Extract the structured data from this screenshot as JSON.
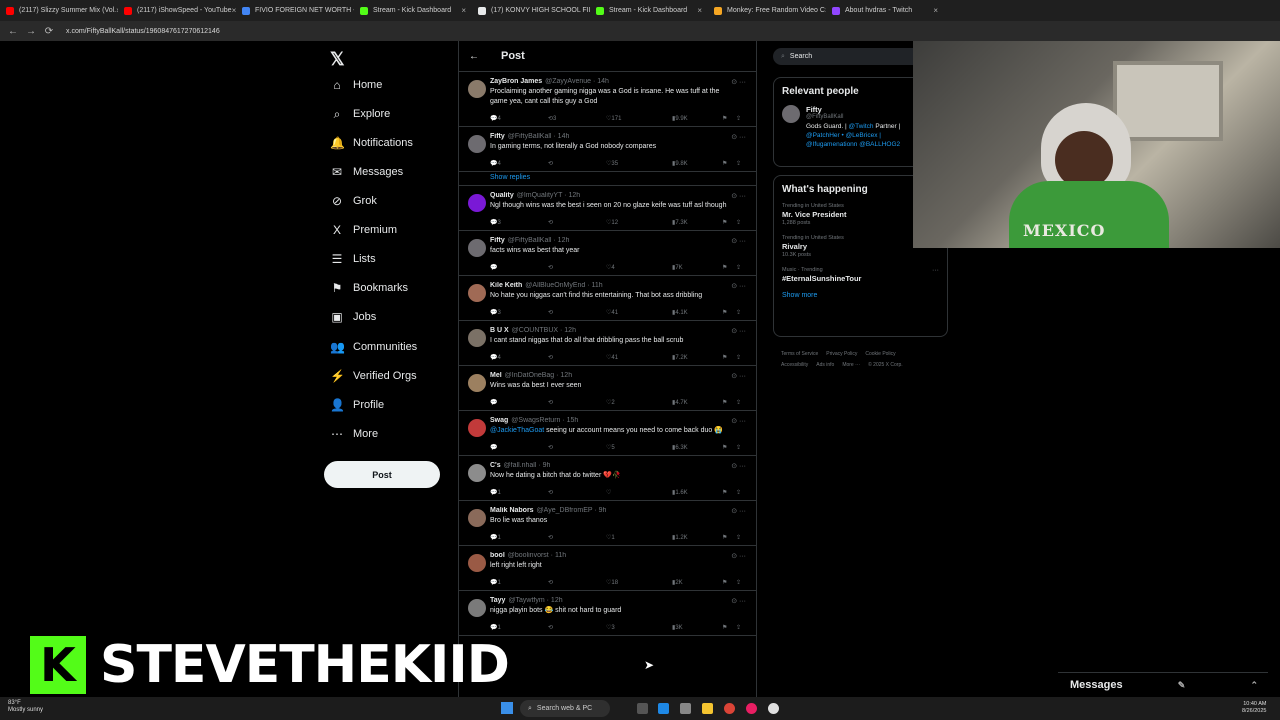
{
  "browser": {
    "tabs": [
      {
        "title": "(2117) Slizzy Summer Mix (Vol.",
        "color": "#ff0000"
      },
      {
        "title": "(2117) iShowSpeed - YouTube",
        "color": "#ff0000"
      },
      {
        "title": "FIVIO FOREIGN NET WORTH -",
        "color": "#4285f4"
      },
      {
        "title": "Stream - Kick Dashboard",
        "color": "#53fc18"
      },
      {
        "title": "(17) KONVY HIGH SCHOOL FII",
        "color": "#e7e9ea"
      },
      {
        "title": "Stream - Kick Dashboard",
        "color": "#53fc18"
      },
      {
        "title": "Monkey: Free Random Video C",
        "color": "#f5a623"
      },
      {
        "title": "About hvdras - Twitch",
        "color": "#9146ff"
      }
    ],
    "url": "x.com/FiftyBallKall/status/1960847617270612146"
  },
  "nav": {
    "items": [
      {
        "label": "Home",
        "icon": "⌂"
      },
      {
        "label": "Explore",
        "icon": "⌕"
      },
      {
        "label": "Notifications",
        "icon": "🔔"
      },
      {
        "label": "Messages",
        "icon": "✉"
      },
      {
        "label": "Grok",
        "icon": "⊘"
      },
      {
        "label": "Premium",
        "icon": "X"
      },
      {
        "label": "Lists",
        "icon": "☰"
      },
      {
        "label": "Bookmarks",
        "icon": "⚑"
      },
      {
        "label": "Jobs",
        "icon": "▣"
      },
      {
        "label": "Communities",
        "icon": "👥"
      },
      {
        "label": "Verified Orgs",
        "icon": "⚡"
      },
      {
        "label": "Profile",
        "icon": "👤"
      },
      {
        "label": "More",
        "icon": "⋯"
      }
    ],
    "post_label": "Post"
  },
  "main": {
    "title": "Post",
    "show_replies": "Show replies",
    "replies": [
      {
        "name": "ZayBron James",
        "handle": "@ZayyAvenue · 14h",
        "text": "Proclaiming another gaming nigga was a God is insane. He was tuff at the game yea, cant call this guy a God",
        "replies": "4",
        "reposts": "3",
        "likes": "171",
        "views": "9.9K",
        "avatar": "#8a7a6a"
      },
      {
        "name": "Fifty",
        "handle": "@FiftyBallKall · 14h",
        "text": "In gaming terms, not literally a God nobody compares",
        "replies": "4",
        "reposts": "",
        "likes": "35",
        "views": "9.8K",
        "avatar": "#6d6b70"
      },
      {
        "name": "Quality",
        "handle": "@ImQualityYT · 12h",
        "text": "Ngl though wins was the best i seen on 20 no glaze keife was tuff asl though",
        "replies": "3",
        "reposts": "",
        "likes": "12",
        "views": "7.3K",
        "avatar": "#7a19d6"
      },
      {
        "name": "Fifty",
        "handle": "@FiftyBallKall · 12h",
        "text": "facts wins was best that year",
        "replies": "",
        "reposts": "",
        "likes": "4",
        "views": "7K",
        "avatar": "#6d6b70"
      },
      {
        "name": "Kile Keith",
        "handle": "@AllBlueOnMyEnd · 11h",
        "text": "No hate you niggas can't find this entertaining. That bot ass dribbling",
        "replies": "3",
        "reposts": "",
        "likes": "41",
        "views": "4.1K",
        "avatar": "#a06a55"
      },
      {
        "name": "B U X",
        "handle": "@COUNTBUX · 12h",
        "text": "I cant stand niggas that do all that dribbling pass the ball scrub",
        "replies": "4",
        "reposts": "",
        "likes": "41",
        "views": "7.2K",
        "avatar": "#7b7166"
      },
      {
        "name": "Mel",
        "handle": "@InDatOneBag · 12h",
        "text": "Wins was da best I ever seen",
        "replies": "",
        "reposts": "",
        "likes": "2",
        "views": "4.7K",
        "avatar": "#9c8060"
      },
      {
        "name": "Swag",
        "handle": "@SwagsReturn · 15h",
        "mention": "@JackieThaGoat",
        "text": " seeing ur account means you need to come back duo 😭",
        "replies": "",
        "reposts": "",
        "likes": "5",
        "views": "6.3K",
        "avatar": "#c23a3a"
      },
      {
        "name": "C's",
        "handle": "@fall.nhall · 9h",
        "text": "Now he dating a bitch that do twitter 💔🥀",
        "replies": "1",
        "reposts": "",
        "likes": "",
        "views": "1.6K",
        "avatar": "#8c8c8c"
      },
      {
        "name": "Malik Nabors",
        "handle": "@Aye_DBfromEP · 9h",
        "text": "Bro lie was thanos",
        "replies": "1",
        "reposts": "",
        "likes": "1",
        "views": "1.2K",
        "avatar": "#8a6a5a"
      },
      {
        "name": "bool",
        "handle": "@boolinvorst · 11h",
        "text": "left right left right",
        "replies": "1",
        "reposts": "",
        "likes": "18",
        "views": "2K",
        "avatar": "#9a5a45"
      },
      {
        "name": "Tayy",
        "handle": "@Taywtfym · 12h",
        "text": "nigga playin bots 😂 shit not hard to guard",
        "replies": "1",
        "reposts": "",
        "likes": "3",
        "views": "3K",
        "avatar": "#7a7a7a"
      }
    ]
  },
  "right": {
    "search_placeholder": "Search",
    "relevant_title": "Relevant people",
    "person": {
      "name": "Fifty",
      "handle": "@FiftyBallKall",
      "bio": "Gods Guard. | ",
      "bio_mentions": "@Twitch",
      "bio2": " Partner |",
      "bio3": "@PatchHer • @LeBricex |",
      "bio4": "@Ifugamenationn @BALLHOG2"
    },
    "happening_title": "What's happening",
    "trends": [
      {
        "context": "Trending in United States",
        "title": "Mr. Vice President",
        "count": "1,288 posts"
      },
      {
        "context": "Trending in United States",
        "title": "Rivalry",
        "count": "10.3K posts"
      },
      {
        "context": "Music · Trending",
        "title": "#EternalSunshineTour",
        "count": ""
      }
    ],
    "show_more": "Show more",
    "footer": [
      "Terms of Service",
      "Privacy Policy",
      "Cookie Policy",
      "Accessibility",
      "Ads info",
      "More ···",
      "© 2025 X Corp."
    ]
  },
  "overlay": {
    "kick_letter": "K",
    "streamer_name": "STEVETHEKIID",
    "shirt_text": "MEXICO"
  },
  "drawer": {
    "messages_label": "Messages"
  },
  "taskbar": {
    "weather_temp": "83°F",
    "weather_desc": "Mostly sunny",
    "search_label": "Search web & PC",
    "time": "10:40 AM",
    "date": "8/26/2025"
  }
}
